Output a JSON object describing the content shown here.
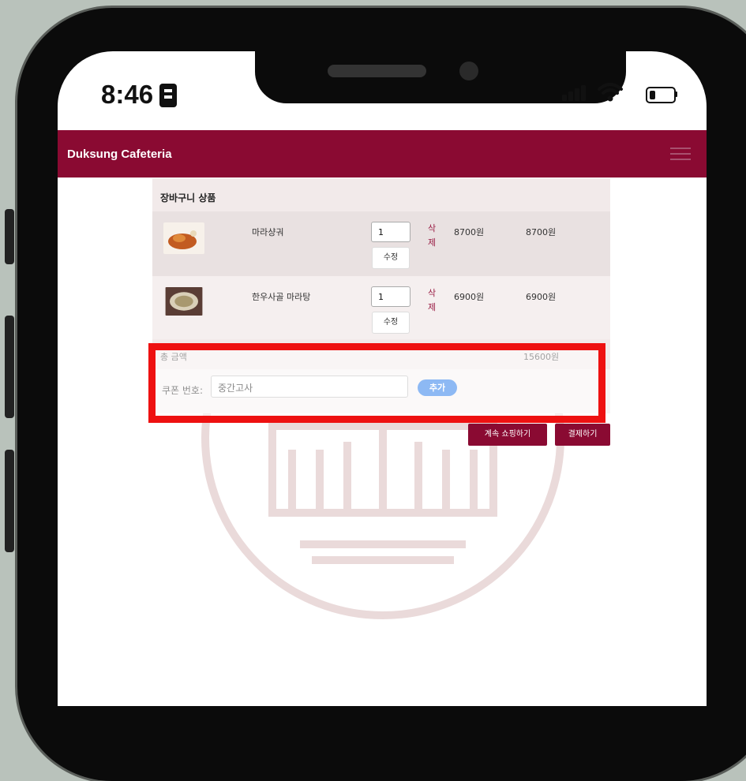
{
  "status_bar": {
    "time": "8:46"
  },
  "navbar": {
    "brand": "Duksung Cafeteria"
  },
  "cart": {
    "header": "장바구니 상품",
    "items": [
      {
        "name": "마라샹궈",
        "quantity": "1",
        "edit_label": "수정",
        "delete_label": "삭제",
        "price": "8700원",
        "subtotal": "8700원"
      },
      {
        "name": "한우사골 마라탕",
        "quantity": "1",
        "edit_label": "수정",
        "delete_label": "삭제",
        "price": "6900원",
        "subtotal": "6900원"
      }
    ],
    "total_label": "총 금액",
    "total_value": "15600원"
  },
  "coupon": {
    "label": "쿠폰 번호:",
    "value": "중간고사",
    "add_button": "추가"
  },
  "actions": {
    "continue_shopping": "계속 쇼핑하기",
    "checkout": "결제하기"
  },
  "colors": {
    "brand": "#8a0a32",
    "highlight": "#ee1111",
    "add_button": "#1a73e8"
  }
}
